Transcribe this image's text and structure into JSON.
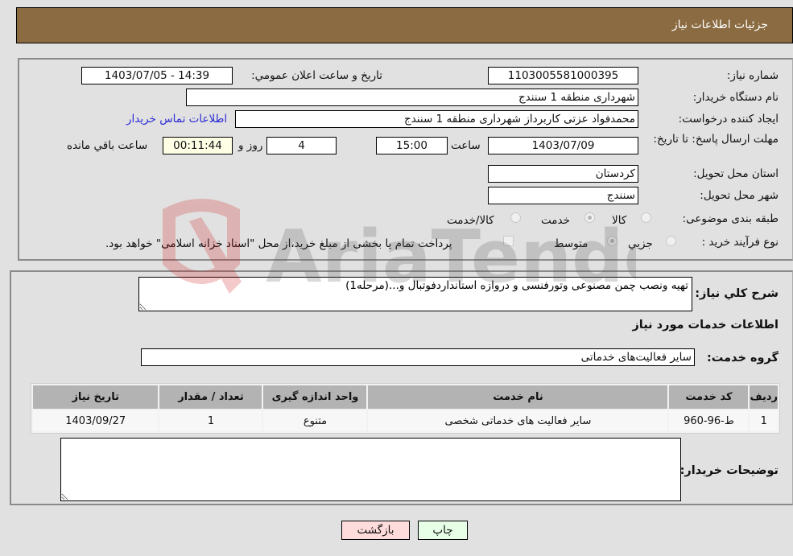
{
  "header": {
    "title": "جزئیات اطلاعات نیاز"
  },
  "form": {
    "need_number_label": "شماره نیاز:",
    "need_number": "1103005581000395",
    "announce_label": "تاریخ و ساعت اعلان عمومي:",
    "announce_value": "1403/07/05 - 14:39",
    "buyer_org_label": "نام دستگاه خريدار:",
    "buyer_org": "شهرداری منطقه 1 سنندج",
    "creator_label": "ایجاد کننده درخواست:",
    "creator": "محمدفواد عزتی کاربرداز شهرداری منطقه 1 سنندج",
    "contact_link": "اطلاعات تماس خریدار",
    "deadline_label": "مهلت ارسال پاسخ: تا تاریخ:",
    "deadline_date": "1403/07/09",
    "time_label": "ساعت",
    "deadline_time": "15:00",
    "days_value": "4",
    "days_label": "روز و",
    "remaining_time": "00:11:44",
    "remaining_label": "ساعت باقي مانده",
    "province_label": "استان محل تحویل:",
    "province": "کردستان",
    "city_label": "شهر محل تحویل:",
    "city": "سنندج",
    "category_label": "طبقه بندی موضوعی:",
    "category_options": [
      {
        "label": "کالا",
        "checked": false
      },
      {
        "label": "خدمت",
        "checked": true
      },
      {
        "label": "کالا/خدمت",
        "checked": false
      }
    ],
    "process_label": "نوع فرآیند خرید :",
    "process_options": [
      {
        "label": "جزيي",
        "checked": false
      },
      {
        "label": "متوسط",
        "checked": true
      }
    ],
    "treasury_checkbox_label": "پرداخت تمام یا بخشی از مبلغ خرید،از محل \"اسناد خزانه اسلامی\" خواهد بود.",
    "treasury_checked": false
  },
  "details": {
    "description_label": "شرح كلي نياز:",
    "description": "تهیه ونصب چمن مصنوعی وتورفنسی و دروازه استانداردفوتبال و...(مرحله1)",
    "services_heading": "اطلاعات خدمات مورد نیاز",
    "service_group_label": "گروه خدمت:",
    "service_group": "سایر فعالیت‌های خدماتی",
    "table": {
      "headers": [
        "ردیف",
        "کد خدمت",
        "نام خدمت",
        "واحد اندازه گیری",
        "تعداد / مقدار",
        "تاریخ نیاز"
      ],
      "rows": [
        [
          "1",
          "ط-96-960",
          "سایر فعالیت های خدماتی شخصی",
          "متنوع",
          "1",
          "1403/09/27"
        ]
      ]
    },
    "buyer_notes_label": "توضیحات خریدار:",
    "buyer_notes": ""
  },
  "buttons": {
    "print": "چاپ",
    "back": "بازگشت"
  },
  "watermark": {
    "text": "AriaTender.neT"
  }
}
